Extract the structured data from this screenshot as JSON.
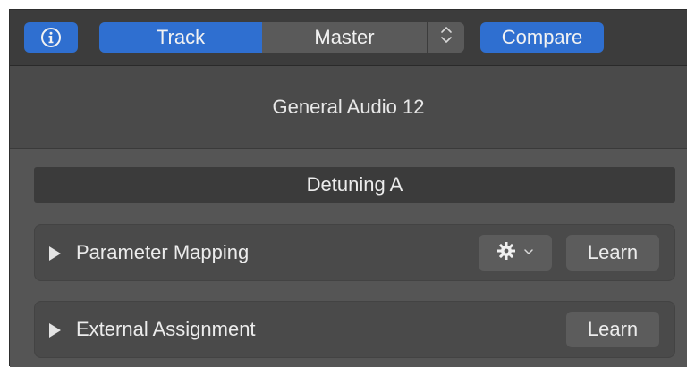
{
  "toolbar": {
    "info_icon": "info-circle-icon",
    "tabs": [
      {
        "label": "Track",
        "selected": true
      },
      {
        "label": "Master",
        "selected": false
      }
    ],
    "stepper_icon": "up-down-chevron-icon",
    "compare_label": "Compare",
    "accent_color": "#2f6fd0"
  },
  "header": {
    "title": "General Audio 12"
  },
  "section": {
    "title": "Detuning A"
  },
  "rows": [
    {
      "label": "Parameter Mapping",
      "has_gear_menu": true,
      "gear_icon": "gear-icon",
      "learn_label": "Learn"
    },
    {
      "label": "External Assignment",
      "has_gear_menu": false,
      "learn_label": "Learn"
    }
  ]
}
